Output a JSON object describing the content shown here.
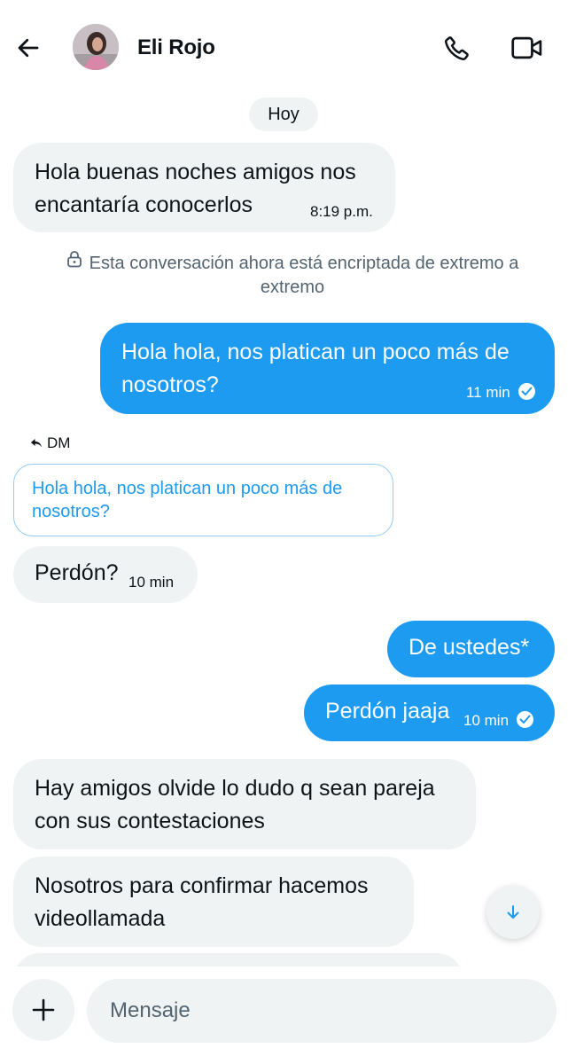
{
  "header": {
    "contact_name": "Eli Rojo"
  },
  "thread": {
    "date_separator": "Hoy",
    "encryption_notice": "Esta conversación ahora está encriptada de extremo a extremo",
    "reply_label": "DM",
    "reply_quote": "Hola hola, nos platican un poco más de nosotros?",
    "messages": [
      {
        "direction": "in",
        "text": "Hola buenas noches amigos nos encantaría conocerlos",
        "time": "8:19 p.m."
      },
      {
        "direction": "out",
        "text": "Hola hola, nos platican un poco más de nosotros?",
        "time": "11 min",
        "read": true
      },
      {
        "direction": "in",
        "text": "Perdón?",
        "time": "10 min"
      },
      {
        "direction": "out",
        "text": "De ustedes*"
      },
      {
        "direction": "out",
        "text": "Perdón jaaja",
        "time": "10 min",
        "read": true
      },
      {
        "direction": "in",
        "text": "Hay amigos olvide lo dudo q sean pareja con sus contestaciones"
      },
      {
        "direction": "in",
        "text": "Nosotros para confirmar hacemos videollamada"
      }
    ]
  },
  "composer": {
    "placeholder": "Mensaje"
  },
  "icons": {
    "back": "arrow-left-icon",
    "call": "phone-icon",
    "video": "video-camera-icon",
    "lock": "lock-icon",
    "reply": "reply-arrow-icon",
    "read": "check-circle-icon",
    "scroll": "arrow-down-icon",
    "add": "plus-icon"
  },
  "colors": {
    "accent": "#1d9bf0",
    "incoming_bubble": "#eff3f4",
    "muted_text": "#536471",
    "text": "#0f1419"
  }
}
